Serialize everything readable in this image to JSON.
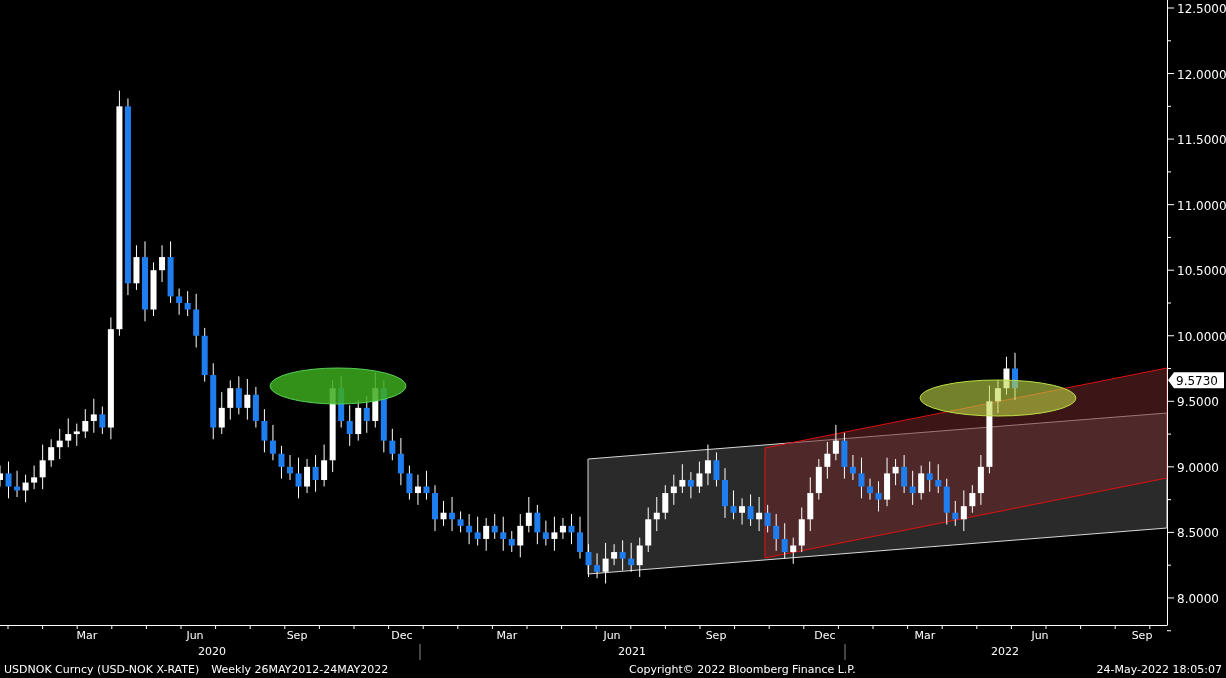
{
  "chart": {
    "y_axis_labels": [
      "12.5000",
      "12.0000",
      "11.5000",
      "11.0000",
      "10.5000",
      "10.0000",
      "9.5000",
      "9.0000",
      "8.5000",
      "8.0000"
    ],
    "x_axis_months": [
      "Mar",
      "Jun",
      "Sep",
      "Dec",
      "Mar",
      "Jun",
      "Sep",
      "Dec",
      "Mar",
      "Jun",
      "Sep"
    ],
    "x_axis_years": [
      "2020",
      "2021",
      "2022"
    ],
    "last_price": "9.5730"
  },
  "footer": {
    "security": "USDNOK Curncy (USD-NOK X-RATE)",
    "period": "Weekly 26MAY2012-24MAY2022",
    "copyright": "Copyright© 2022 Bloomberg Finance L.P.",
    "timestamp": "24-May-2022 18:05:07"
  }
}
